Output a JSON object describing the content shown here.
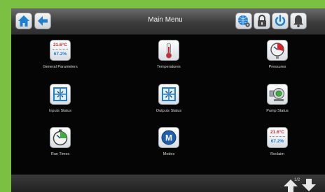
{
  "header": {
    "title": "Main Menu"
  },
  "menu": [
    {
      "label": "General Parameters",
      "temp": "21.6°C",
      "humidity": "67.2%",
      "icon": "temperature-humidity-readout-icon"
    },
    {
      "label": "Temperatures",
      "icon": "thermometer-icon"
    },
    {
      "label": "Pressures",
      "icon": "pressure-gauge-icon"
    },
    {
      "label": "Inputs Status",
      "icon": "inputs-grid-icon"
    },
    {
      "label": "Outputs Status",
      "icon": "outputs-grid-icon"
    },
    {
      "label": "Pump Status",
      "icon": "pump-icon"
    },
    {
      "label": "Run Times",
      "icon": "stopwatch-icon"
    },
    {
      "label": "Modes",
      "icon": "mode-m-icon"
    },
    {
      "label": "Reclaim",
      "temp": "21.6°C",
      "humidity": "67.2%",
      "icon": "temperature-humidity-readout-icon"
    }
  ],
  "footer": {
    "page_indicator": "1/2"
  },
  "colors": {
    "accent": "#1f7fd0",
    "frame": "#7cc043",
    "red": "#d5252b"
  }
}
